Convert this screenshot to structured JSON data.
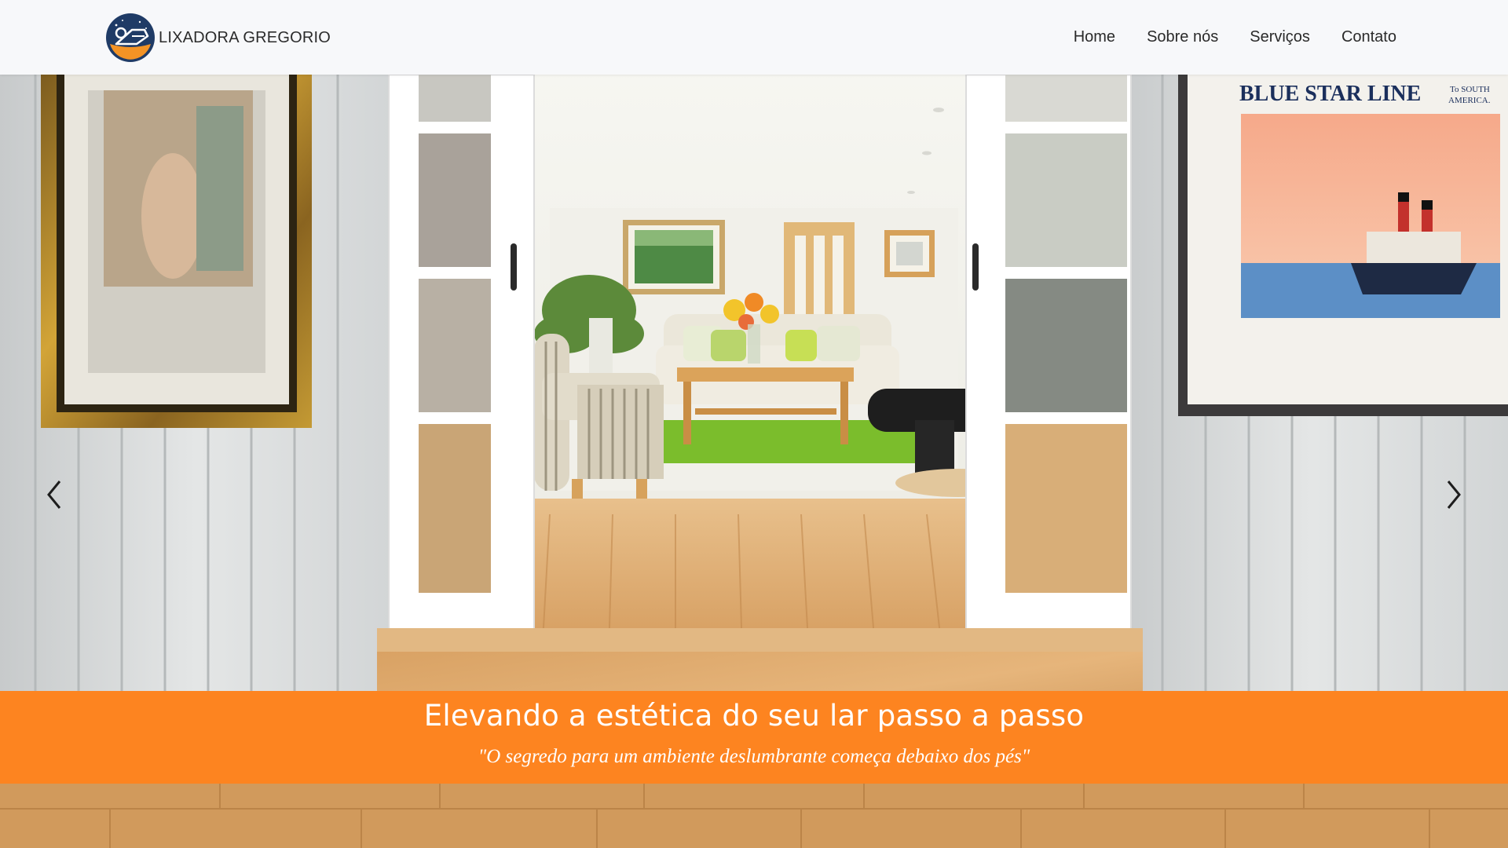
{
  "header": {
    "brand_name": "LIXADORA GREGORIO",
    "logo_icon": "sanding-machine-logo-icon",
    "nav": [
      {
        "label": "Home"
      },
      {
        "label": "Sobre nós"
      },
      {
        "label": "Serviços"
      },
      {
        "label": "Contato"
      }
    ]
  },
  "hero": {
    "image": "living-room-wood-floor-photo",
    "poster_title": "BLUE STAR LINE",
    "poster_subtitle_1": "To SOUTH",
    "poster_subtitle_2": "AMERICA.",
    "prev_icon": "chevron-left-icon",
    "next_icon": "chevron-right-icon"
  },
  "caption": {
    "title": "Elevando a estética do seu lar passo a passo",
    "quote": "\"O segredo para um ambiente deslumbrante começa debaixo dos pés\""
  },
  "colors": {
    "accent": "#fd8420",
    "header_bg": "#f7f8fa",
    "logo_navy": "#1f3b66"
  }
}
